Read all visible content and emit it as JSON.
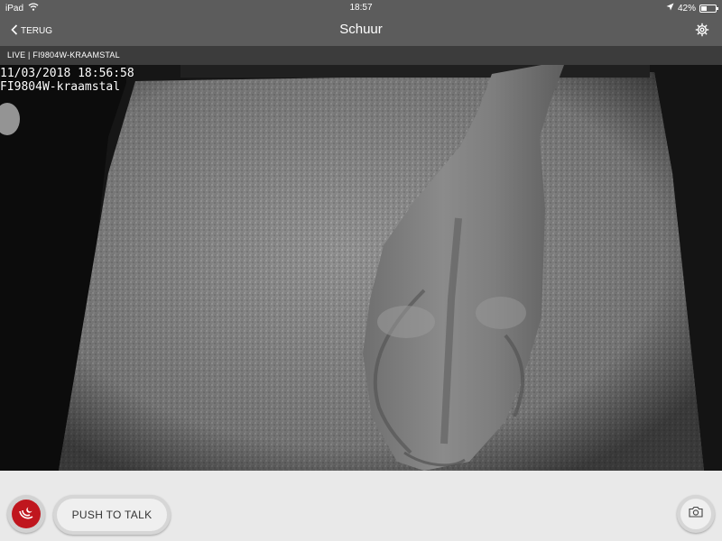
{
  "status_bar": {
    "device": "iPad",
    "time": "18:57",
    "battery_percent": "42%",
    "battery_level": 0.42
  },
  "nav": {
    "back_label": "TERUG",
    "title": "Schuur"
  },
  "stream": {
    "label": "LIVE | FI9804W-KRAAMSTAL"
  },
  "video": {
    "timestamp": "11/03/2018 18:56:58",
    "camera_name": "FI9804W-kraamstal"
  },
  "controls": {
    "talk_label": "PUSH TO TALK"
  },
  "colors": {
    "bar": "#5c5c5c",
    "live_bar": "#3c3c3c",
    "accent_red": "#c0161e",
    "control_bg": "#e9e9e9"
  },
  "icons": [
    "wifi-icon",
    "back-chevron-icon",
    "gear-icon",
    "location-arrow-icon",
    "battery-icon",
    "night-vision-icon",
    "camera-icon"
  ]
}
